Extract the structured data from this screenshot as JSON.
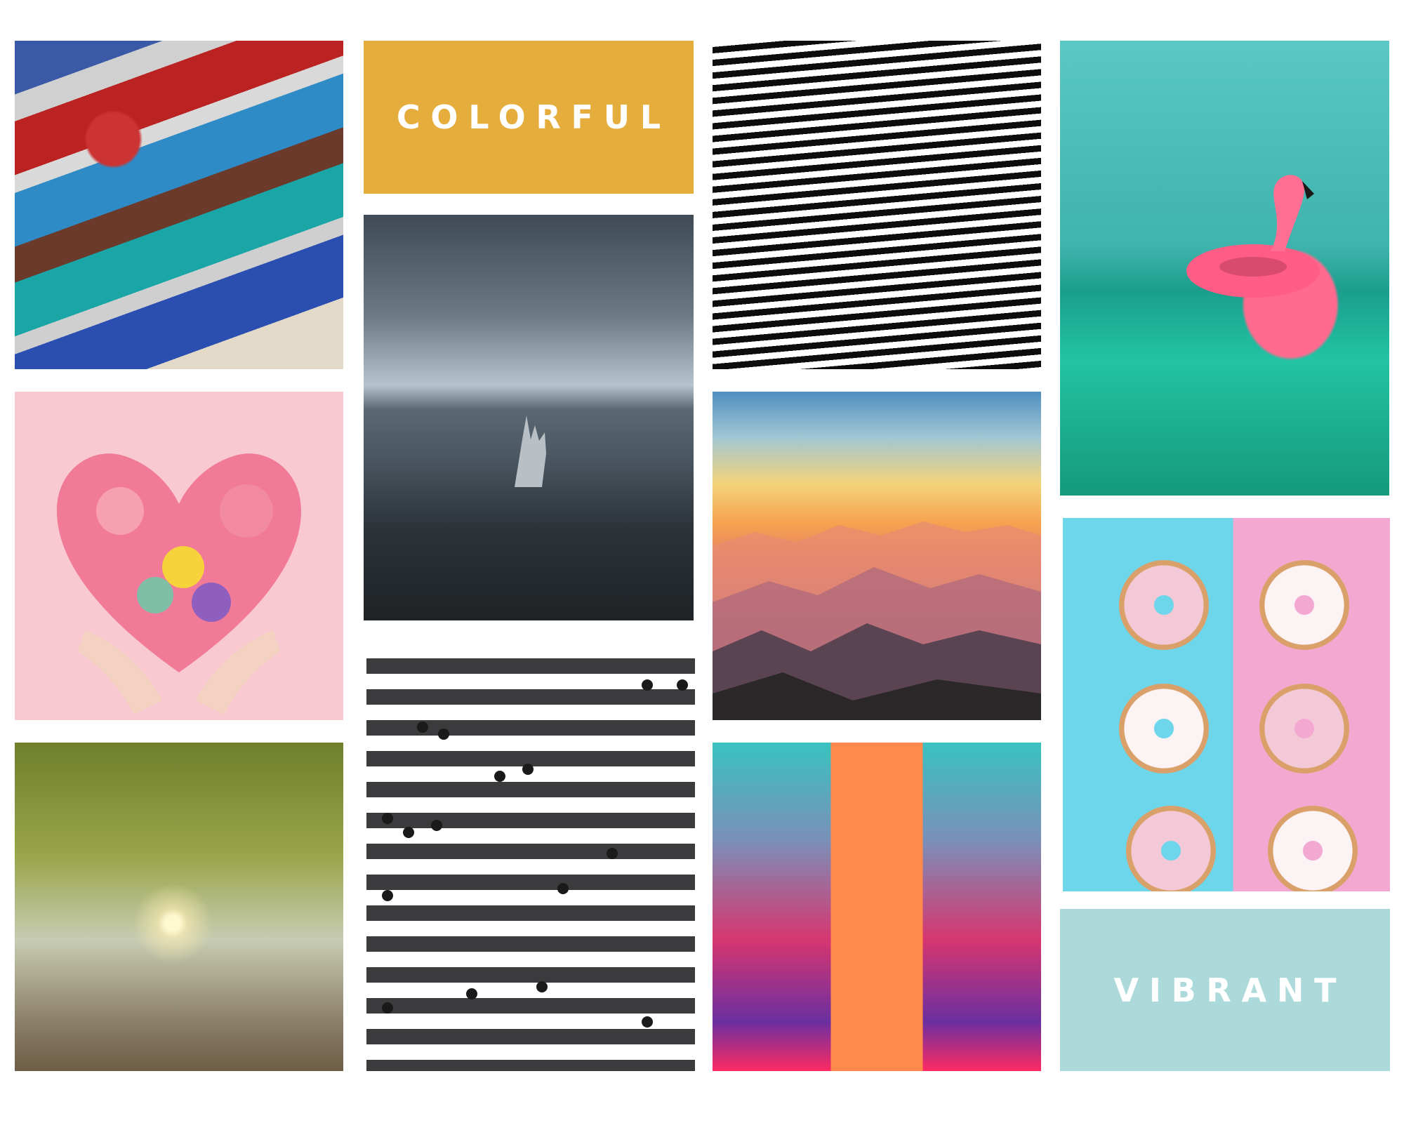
{
  "collage": {
    "labels": {
      "colorful": "COLORFUL",
      "vibrant": "VIBRANT"
    },
    "photos": [
      "paintbrushes",
      "flower-heart",
      "banyan-tree",
      "hand-in-sea",
      "crosswalk",
      "wave-pattern",
      "mountain-sunset",
      "neon-corridor",
      "flamingo-float",
      "donuts"
    ],
    "colors": {
      "background": "#ffffff",
      "colorful_tile": "#e5ad3c",
      "vibrant_tile": "#acdadb",
      "text": "#ffffff"
    }
  }
}
